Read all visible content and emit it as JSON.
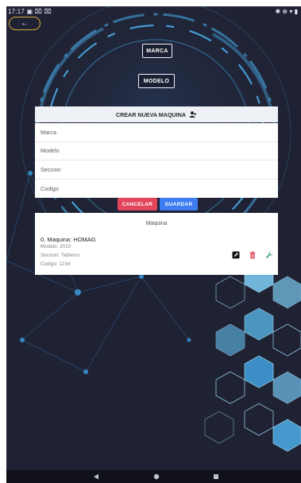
{
  "statusbar": {
    "time": "17:17",
    "left_icons_text": "▣ ⌧ ⌧",
    "right_icons_text": "✱ ⊕ ▾ ▮"
  },
  "top": {
    "back_label": "←",
    "brand_button": "MARCA",
    "model_button": "MODELO"
  },
  "form": {
    "title": "CREAR NUEVA MAQUINA",
    "fields": [
      {
        "placeholder": "Marca"
      },
      {
        "placeholder": "Modelo"
      },
      {
        "placeholder": "Seccion"
      },
      {
        "placeholder": "Codigo"
      }
    ],
    "cancel": "CANCELAR",
    "save": "GUARDAR"
  },
  "list": {
    "title": "Maquina",
    "items": [
      {
        "title": "0. Maquina: HOMAG",
        "modelo": "Modelo: 2010",
        "seccion": "Seccion: Tableros",
        "codigo": "Codigo: 1234"
      }
    ]
  },
  "colors": {
    "accent_gold": "#d9a73a",
    "cancel": "#e3465c",
    "save": "#3d7df1",
    "edit": "#111111",
    "delete": "#e04b5a",
    "tool": "#3aa46f"
  },
  "nav": {
    "back_icon": "back-triangle-icon",
    "home_icon": "home-circle-icon",
    "recent_icon": "recent-square-icon"
  }
}
